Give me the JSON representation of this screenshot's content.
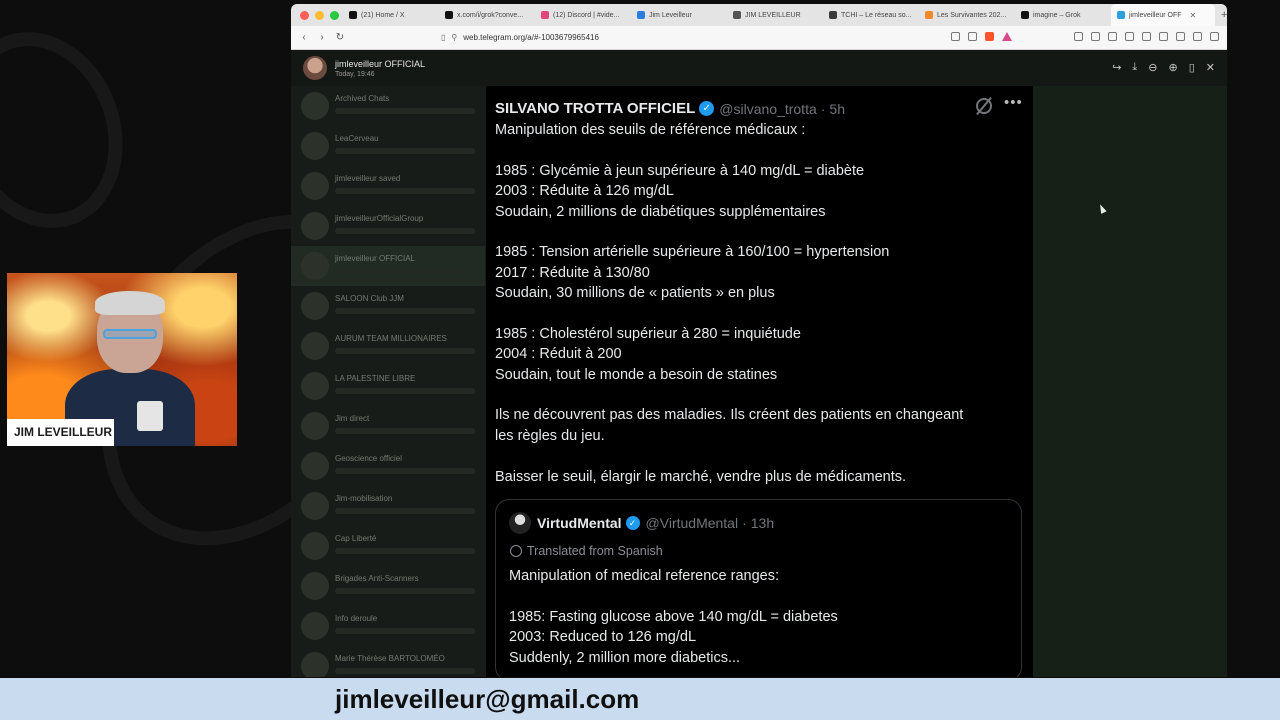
{
  "browser": {
    "tabs": [
      {
        "label": "(21) Home / X",
        "color": "#111111"
      },
      {
        "label": "x.com/i/grok?conve...",
        "color": "#111111"
      },
      {
        "label": "(12) Discord | #vide...",
        "color": "#e0457b"
      },
      {
        "label": "Jim Leveilleur",
        "color": "#2a7de1"
      },
      {
        "label": "JIM LEVEILLEUR",
        "color": "#555555"
      },
      {
        "label": "TCHI – Le réseau so...",
        "color": "#3a3a3a"
      },
      {
        "label": "Les Survivantes 202...",
        "color": "#f08a24"
      },
      {
        "label": "imagine – Grok",
        "color": "#111111"
      },
      {
        "label": "jimleveilleur OFF",
        "color": "#2aa1da",
        "active": true
      }
    ],
    "url": "web.telegram.org/a/#-1003679965416"
  },
  "telegram": {
    "channel_name": "jimleveilleur OFFICIAL",
    "timestamp": "Today, 19:46",
    "chats": [
      "Archived Chats",
      "LeaCerveau",
      "jimleveilleur saved",
      "jimleveilleurOfficialGroup",
      "jimleveilleur OFFICIAL",
      "SALOON Club JJM",
      "AURUM TEAM MILLIONAIRES",
      "LA PALESTINE LIBRE",
      "Jim direct",
      "Geoscience officiel",
      "Jim-mobilisation",
      "Cap Liberté",
      "Brigades Anti-Scanners",
      "Info deroule",
      "Marie Thérèse BARTOLOMÉO"
    ]
  },
  "tweet": {
    "author": "SILVANO TROTTA OFFICIEL",
    "handle": "@silvano_trotta",
    "time": "5h",
    "lines": [
      "Manipulation des seuils de référence médicaux :",
      "",
      "1985 : Glycémie à jeun supérieure à 140 mg/dL = diabète",
      "2003 : Réduite à 126 mg/dL",
      "Soudain, 2 millions de diabétiques supplémentaires",
      "",
      "1985 : Tension artérielle supérieure à 160/100 = hypertension",
      "2017 : Réduite à 130/80",
      "Soudain, 30 millions de « patients » en plus",
      "",
      "1985 : Cholestérol supérieur à 280 = inquiétude",
      "2004 : Réduit à 200",
      "Soudain, tout le monde a besoin de statines",
      "",
      "Ils ne découvrent pas des maladies. Ils créent des patients en changeant",
      "les règles du jeu.",
      "",
      "Baisser le seuil, élargir le marché, vendre plus de médicaments."
    ],
    "quote": {
      "author": "VirtudMental",
      "handle": "@VirtudMental",
      "time": "13h",
      "translated_label": "Translated from Spanish",
      "lines": [
        "Manipulation of medical reference ranges:",
        "",
        "1985: Fasting glucose above 140 mg/dL = diabetes",
        "2003: Reduced to 126 mg/dL",
        "Suddenly, 2 million more diabetics..."
      ]
    }
  },
  "webcam": {
    "label": "JIM LEVEILLEUR"
  },
  "banner": {
    "email": "jimleveilleur@gmail.com"
  },
  "colors": {
    "verified": "#1d9bf0",
    "banner_bg": "#c9dbee"
  }
}
